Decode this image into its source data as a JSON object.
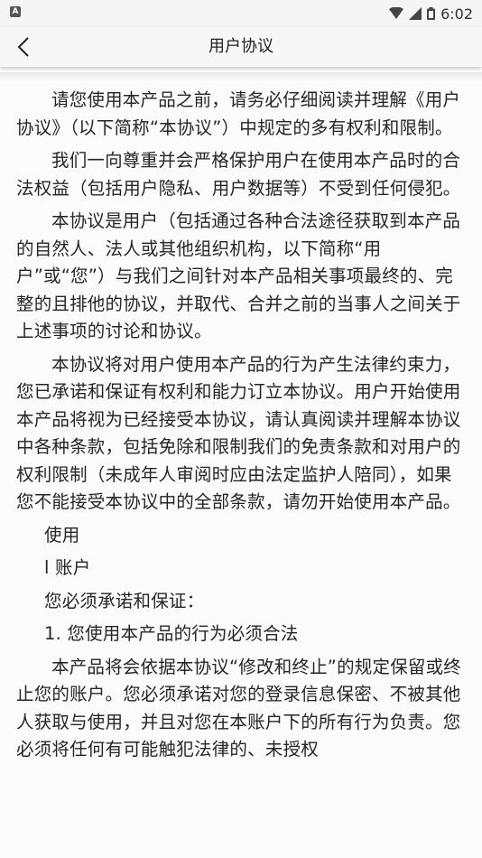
{
  "status_bar": {
    "left_icon": "A",
    "time": "6:02",
    "icons": [
      "wifi-icon",
      "signal-icon",
      "battery-icon"
    ]
  },
  "app_bar": {
    "back_icon": "chevron-left-icon",
    "title": "用户协议"
  },
  "agreement": {
    "paragraphs": [
      "请您使用本产品之前，请务必仔细阅读并理解《用户协议》（以下简称“本协议”）中规定的多有权利和限制。",
      "我们一向尊重并会严格保护用户在使用本产品时的合法权益（包括用户隐私、用户数据等）不受到任何侵犯。",
      "本协议是用户（包括通过各种合法途径获取到本产品的自然人、法人或其他组织机构，以下简称“用户”或“您”）与我们之间针对本产品相关事项最终的、完整的且排他的协议，并取代、合并之前的当事人之间关于上述事项的讨论和协议。",
      "本协议将对用户使用本产品的行为产生法律约束力，您已承诺和保证有权利和能力订立本协议。用户开始使用本产品将视为已经接受本协议，请认真阅读并理解本协议中各种条款，包括免除和限制我们的免责条款和对用户的权利限制（未成年人审阅时应由法定监护人陪同），如果您不能接受本协议中的全部条款，请勿开始使用本产品。"
    ],
    "section_use": "使用",
    "section_account": "l 账户",
    "must_promise": "您必须承诺和保证：",
    "item_1": "1. 您使用本产品的行为必须合法",
    "paragraph_last": "本产品将会依据本协议“修改和终止”的规定保留或终止您的账户。您必须承诺对您的登录信息保密、不被其他人获取与使用，并且对您在本账户下的所有行为负责。您必须将任何有可能触犯法律的、未授权"
  }
}
